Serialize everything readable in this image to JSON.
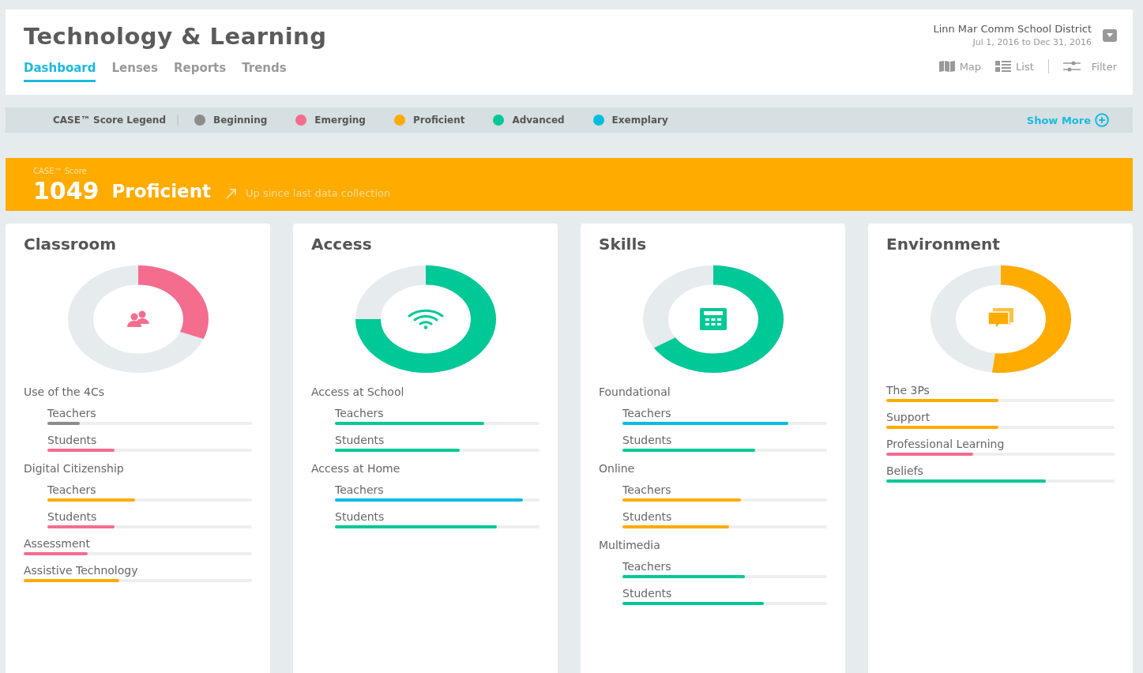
{
  "header": {
    "title": "Technology & Learning",
    "tabs": [
      {
        "label": "Dashboard",
        "selected": true
      },
      {
        "label": "Lenses",
        "selected": false
      },
      {
        "label": "Reports",
        "selected": false
      },
      {
        "label": "Trends",
        "selected": false
      }
    ],
    "district": "Linn Mar Comm School District",
    "date_range": "Jul 1, 2016 to Dec 31, 2016",
    "views": [
      "Map",
      "List"
    ],
    "filter": "Filter"
  },
  "legend": {
    "title": "CASE™ Score Legend",
    "items": [
      {
        "label": "Beginning",
        "color": "#8c8c8c"
      },
      {
        "label": "Emerging",
        "color": "#f46d8e"
      },
      {
        "label": "Proficient",
        "color": "#ffab00"
      },
      {
        "label": "Advanced",
        "color": "#00c896"
      },
      {
        "label": "Exemplary",
        "color": "#00bde0"
      }
    ],
    "show_more": "Show More"
  },
  "score": {
    "label": "CASE™ Score",
    "value": "1049",
    "level_name": "Proficient",
    "trend": "Up since last data collection"
  },
  "cards": [
    {
      "title": "Classroom",
      "level": 0.31,
      "color": "#f46d8e",
      "items": [
        {
          "kind": "group",
          "label": "Use of the 4Cs",
          "children": [
            {
              "label": "Teachers",
              "level": 0.16,
              "color": "#8c8c8c"
            },
            {
              "label": "Students",
              "level": 0.33,
              "color": "#f46d8e"
            }
          ]
        },
        {
          "kind": "group",
          "label": "Digital Citizenship",
          "children": [
            {
              "label": "Teachers",
              "level": 0.43,
              "color": "#ffab00"
            },
            {
              "label": "Students",
              "level": 0.33,
              "color": "#f46d8e"
            }
          ]
        },
        {
          "kind": "metric",
          "label": "Assessment",
          "level": 0.28,
          "color": "#f46d8e"
        },
        {
          "kind": "metric",
          "label": "Assistive Technology",
          "level": 0.42,
          "color": "#ffab00"
        }
      ]
    },
    {
      "title": "Access",
      "level": 0.75,
      "color": "#00c896",
      "items": [
        {
          "kind": "group",
          "label": "Access at School",
          "children": [
            {
              "label": "Teachers",
              "level": 0.73,
              "color": "#00c896"
            },
            {
              "label": "Students",
              "level": 0.61,
              "color": "#00c896"
            }
          ]
        },
        {
          "kind": "group",
          "label": "Access at Home",
          "children": [
            {
              "label": "Teachers",
              "level": 0.92,
              "color": "#00bde0"
            },
            {
              "label": "Students",
              "level": 0.79,
              "color": "#00c896"
            }
          ]
        }
      ]
    },
    {
      "title": "Skills",
      "level": 0.66,
      "color": "#00c896",
      "items": [
        {
          "kind": "group",
          "label": "Foundational",
          "children": [
            {
              "label": "Teachers",
              "level": 0.81,
              "color": "#00bde0"
            },
            {
              "label": "Students",
              "level": 0.65,
              "color": "#00c896"
            }
          ]
        },
        {
          "kind": "group",
          "label": "Online",
          "children": [
            {
              "label": "Teachers",
              "level": 0.58,
              "color": "#ffab00"
            },
            {
              "label": "Students",
              "level": 0.52,
              "color": "#ffab00"
            }
          ]
        },
        {
          "kind": "group",
          "label": "Multimedia",
          "children": [
            {
              "label": "Teachers",
              "level": 0.6,
              "color": "#00c896"
            },
            {
              "label": "Students",
              "level": 0.69,
              "color": "#00c896"
            }
          ]
        }
      ]
    },
    {
      "title": "Environment",
      "level": 0.52,
      "color": "#ffab00",
      "items": [
        {
          "kind": "metric",
          "label": "The 3Ps",
          "level": 0.49,
          "color": "#ffab00"
        },
        {
          "kind": "metric",
          "label": "Support",
          "level": 0.49,
          "color": "#ffab00"
        },
        {
          "kind": "metric",
          "label": "Professional Learning",
          "level": 0.38,
          "color": "#f46d8e"
        },
        {
          "kind": "metric",
          "label": "Beliefs",
          "level": 0.7,
          "color": "#00c896"
        }
      ]
    }
  ]
}
